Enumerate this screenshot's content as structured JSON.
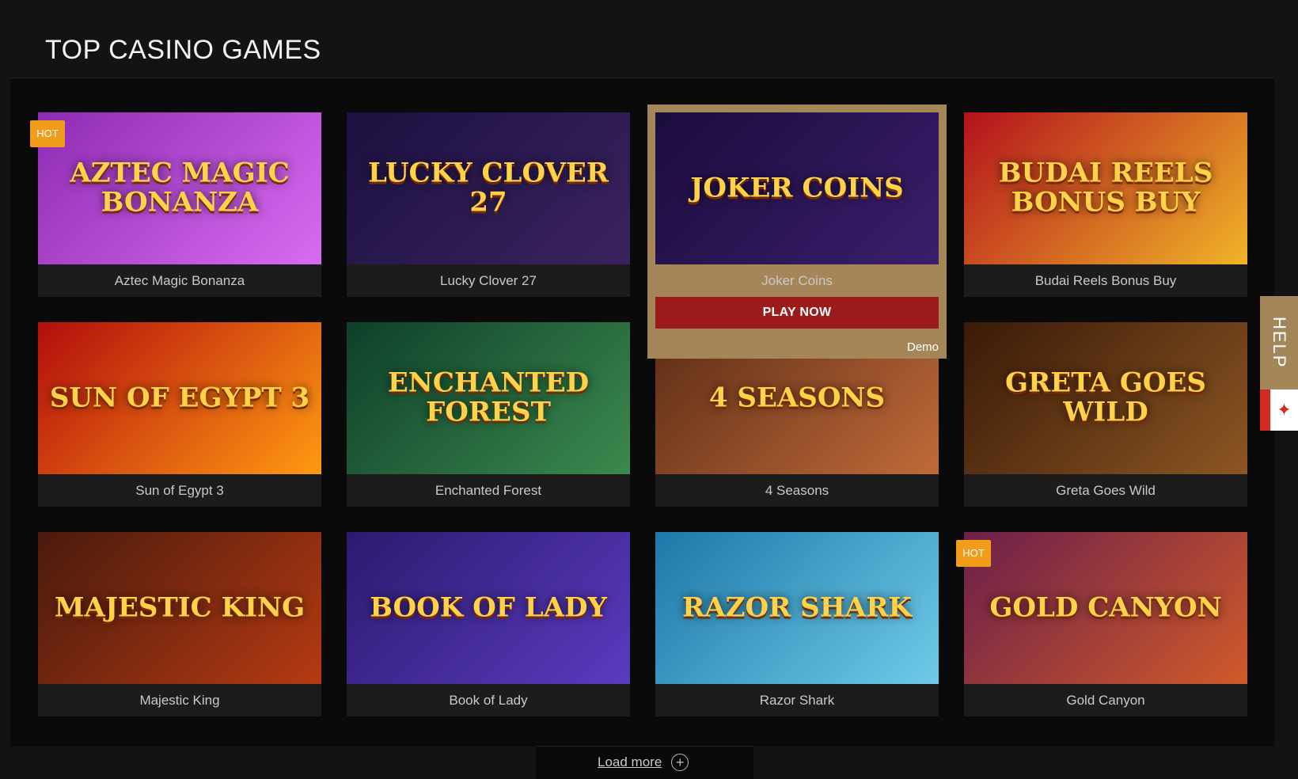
{
  "section": {
    "title": "TOP CASINO GAMES"
  },
  "games": [
    {
      "name": "Aztec Magic Bonanza",
      "badge": "HOT",
      "logo": "AZTEC MAGIC BONANZA",
      "colors": [
        "#8e2bb3",
        "#d86cf0"
      ]
    },
    {
      "name": "Lucky Clover 27",
      "badge": "",
      "logo": "LUCKY CLOVER 27",
      "colors": [
        "#1c1140",
        "#3b235f"
      ]
    },
    {
      "name": "Joker Coins",
      "badge": "",
      "logo": "JOKER COINS",
      "colors": [
        "#1b0c3d",
        "#3a1f6b"
      ]
    },
    {
      "name": "Budai Reels Bonus Buy",
      "badge": "",
      "logo": "BUDAI REELS BONUS BUY",
      "colors": [
        "#b3121c",
        "#f0b428"
      ]
    },
    {
      "name": "Sun of Egypt 3",
      "badge": "",
      "logo": "SUN OF EGYPT 3",
      "colors": [
        "#b20d0d",
        "#ff9a12"
      ]
    },
    {
      "name": "Enchanted Forest",
      "badge": "",
      "logo": "ENCHANTED FOREST",
      "colors": [
        "#0e3f2a",
        "#3b8a4e"
      ]
    },
    {
      "name": "4 Seasons",
      "badge": "",
      "logo": "4 SEASONS",
      "colors": [
        "#5b2d16",
        "#c16a3a"
      ]
    },
    {
      "name": "Greta Goes Wild",
      "badge": "",
      "logo": "GRETA GOES WILD",
      "colors": [
        "#3a1a08",
        "#8c5623"
      ]
    },
    {
      "name": "Majestic King",
      "badge": "",
      "logo": "MAJESTIC KING",
      "colors": [
        "#4a1a0e",
        "#b53a12"
      ]
    },
    {
      "name": "Book of Lady",
      "badge": "",
      "logo": "BOOK OF LADY",
      "colors": [
        "#2c1a6e",
        "#5a3bc0"
      ]
    },
    {
      "name": "Razor Shark",
      "badge": "",
      "logo": "RAZOR SHARK",
      "colors": [
        "#1c78a8",
        "#6fcbe8"
      ]
    },
    {
      "name": "Gold Canyon",
      "badge": "HOT",
      "logo": "GOLD CANYON",
      "colors": [
        "#6b1f4a",
        "#d05a2a"
      ]
    }
  ],
  "active_card": {
    "index": 2,
    "play_label": "PLAY NOW",
    "demo_label": "Demo"
  },
  "load_more": {
    "label": "Load more",
    "icon": "plus-circle-icon"
  },
  "help": {
    "label": "HELP",
    "flag": "canada-flag-icon"
  },
  "colors": {
    "accent_gold": "#a58659",
    "play_red": "#9c1b1b",
    "hot_orange": "#f29c1b"
  }
}
